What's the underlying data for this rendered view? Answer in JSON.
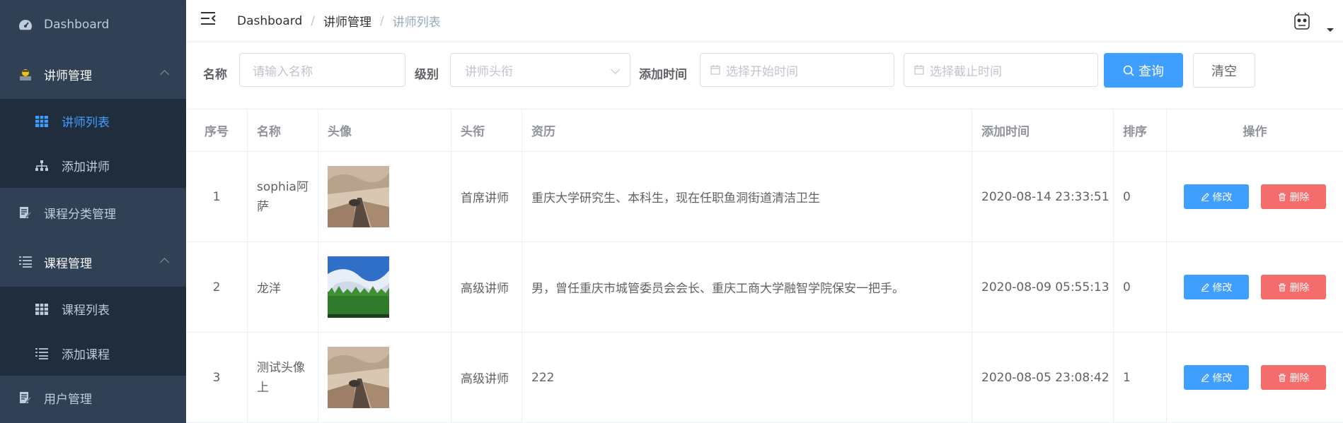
{
  "sidebar": {
    "items": [
      {
        "label": "Dashboard",
        "icon": "dashboard-icon"
      },
      {
        "label": "讲师管理",
        "icon": "teacher-icon",
        "expanded": true,
        "children": [
          {
            "label": "讲师列表",
            "icon": "table-icon",
            "active": true
          },
          {
            "label": "添加讲师",
            "icon": "tree-icon"
          }
        ]
      },
      {
        "label": "课程分类管理",
        "icon": "edit-document-icon"
      },
      {
        "label": "课程管理",
        "icon": "list-icon",
        "expanded": true,
        "children": [
          {
            "label": "课程列表",
            "icon": "table-icon"
          },
          {
            "label": "添加课程",
            "icon": "list-icon"
          }
        ]
      },
      {
        "label": "用户管理",
        "icon": "edit-document-icon"
      }
    ]
  },
  "header": {
    "breadcrumb": [
      "Dashboard",
      "讲师管理",
      "讲师列表"
    ]
  },
  "search": {
    "name_label": "名称",
    "name_placeholder": "请输入名称",
    "level_label": "级别",
    "level_placeholder": "讲师头衔",
    "time_label": "添加时间",
    "start_placeholder": "选择开始时间",
    "end_placeholder": "选择截止时间",
    "query_label": "查询",
    "clear_label": "清空"
  },
  "table": {
    "columns": [
      "序号",
      "名称",
      "头像",
      "头衔",
      "资历",
      "添加时间",
      "排序",
      "操作"
    ],
    "rows": [
      {
        "index": "1",
        "name": "sophia阿萨",
        "avatar": "desert-road-image",
        "level": "首席讲师",
        "intro": "重庆大学研究生、本科生，现在任职鱼洞街道清洁卫生",
        "time": "2020-08-14 23:33:51",
        "sort": "0"
      },
      {
        "index": "2",
        "name": "龙洋",
        "avatar": "forest-sky-image",
        "level": "高级讲师",
        "intro": "男，曾任重庆市城管委员会会长、重庆工商大学融智学院保安一把手。",
        "time": "2020-08-09 05:55:13",
        "sort": "0"
      },
      {
        "index": "3",
        "name": "测试头像上",
        "avatar": "desert-road-image",
        "level": "高级讲师",
        "intro": "222",
        "time": "2020-08-05 23:08:42",
        "sort": "1"
      }
    ],
    "edit_label": "修改",
    "delete_label": "删除"
  },
  "colors": {
    "primary": "#409eff",
    "danger": "#f56c6c",
    "sidebar": "#304156",
    "submenu": "#1f2d3d"
  }
}
